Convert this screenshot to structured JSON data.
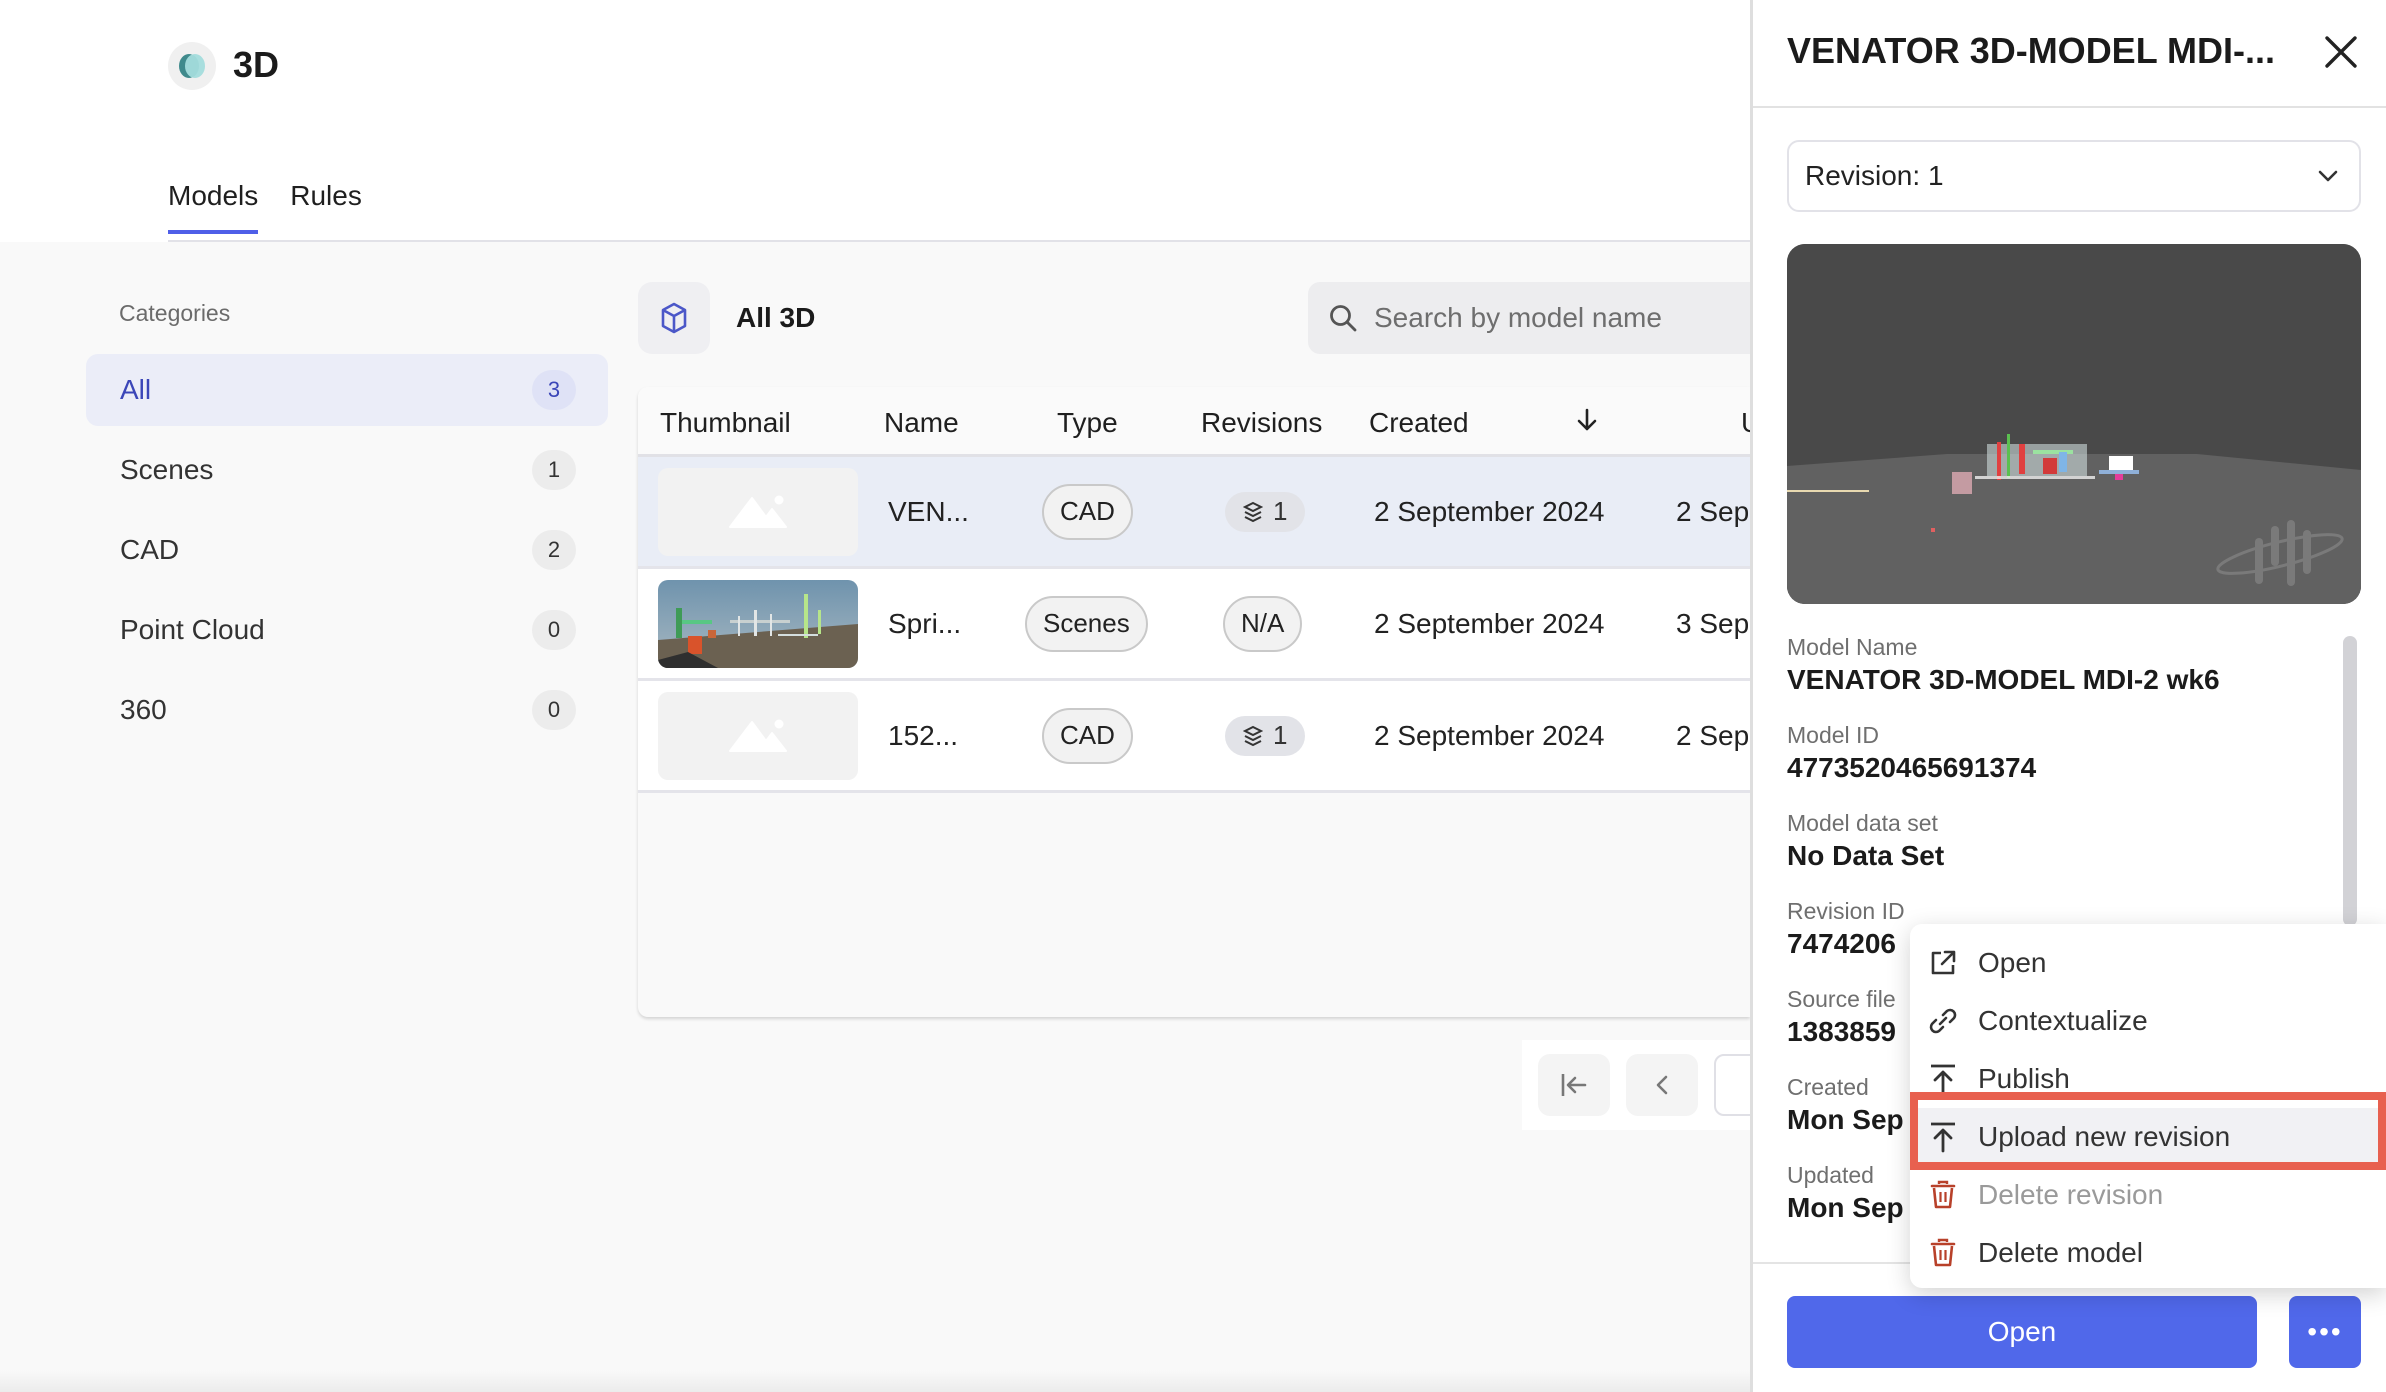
{
  "app": {
    "title": "3D",
    "logo_icon": "3d-app-logo-icon"
  },
  "tabs": [
    {
      "label": "Models",
      "active": true
    },
    {
      "label": "Rules",
      "active": false
    }
  ],
  "sidebar": {
    "title": "Categories",
    "items": [
      {
        "label": "All",
        "count": "3",
        "active": true
      },
      {
        "label": "Scenes",
        "count": "1",
        "active": false
      },
      {
        "label": "CAD",
        "count": "2",
        "active": false
      },
      {
        "label": "Point Cloud",
        "count": "0",
        "active": false
      },
      {
        "label": "360",
        "count": "0",
        "active": false
      }
    ]
  },
  "toolbar": {
    "icon": "cube-icon",
    "title": "All 3D",
    "search_placeholder": "Search by model name",
    "search_value": ""
  },
  "table": {
    "columns": [
      "Thumbnail",
      "Name",
      "Type",
      "Revisions",
      "Created",
      "U"
    ],
    "sort_icon": "arrow-down-icon",
    "rows": [
      {
        "thumbnail": "placeholder",
        "name": "VEN...",
        "type": "CAD",
        "revisions": "1",
        "revisions_icon": "layers-icon",
        "created": "2 September 2024",
        "updated": "2 Sep",
        "selected": true
      },
      {
        "thumbnail": "scene-image",
        "name": "Spri...",
        "type": "Scenes",
        "revisions": "N/A",
        "revisions_icon": null,
        "created": "2 September 2024",
        "updated": "3 Sep",
        "selected": false
      },
      {
        "thumbnail": "placeholder",
        "name": "152...",
        "type": "CAD",
        "revisions": "1",
        "revisions_icon": "layers-icon",
        "created": "2 September 2024",
        "updated": "2 Sep",
        "selected": false
      }
    ]
  },
  "pagination": {
    "first_icon": "first-page-icon",
    "prev_icon": "chevron-left-icon"
  },
  "panel": {
    "title": "VENATOR 3D-MODEL MDI-...",
    "revision_select": "Revision: 1",
    "details": [
      {
        "label": "Model Name",
        "value": "VENATOR 3D-MODEL MDI-2 wk6"
      },
      {
        "label": "Model ID",
        "value": "4773520465691374"
      },
      {
        "label": "Model data set",
        "value": "No Data Set"
      },
      {
        "label": "Revision ID",
        "value": "7474206"
      },
      {
        "label": "Source file",
        "value": "1383859"
      },
      {
        "label": "Created",
        "value": "Mon Sep"
      },
      {
        "label": "Updated",
        "value": "Mon Sep"
      }
    ],
    "open_button": "Open",
    "more_button": "•••"
  },
  "menu": {
    "items": [
      {
        "label": "Open",
        "icon": "external-link-icon",
        "disabled": false,
        "highlighted": false
      },
      {
        "label": "Contextualize",
        "icon": "link-icon",
        "disabled": false,
        "highlighted": false
      },
      {
        "label": "Publish",
        "icon": "upload-icon",
        "disabled": false,
        "highlighted": false
      },
      {
        "label": "Upload new revision",
        "icon": "upload-icon",
        "disabled": false,
        "highlighted": true
      },
      {
        "label": "Delete revision",
        "icon": "trash-icon",
        "disabled": true,
        "highlighted": false
      },
      {
        "label": "Delete model",
        "icon": "trash-icon",
        "disabled": false,
        "highlighted": false
      }
    ]
  },
  "colors": {
    "accent": "#4f5fe8",
    "primary_button": "#5068ea",
    "danger_icon": "#b8412a",
    "highlight_outline": "#e8604f",
    "selected_row": "#e9edf6"
  }
}
